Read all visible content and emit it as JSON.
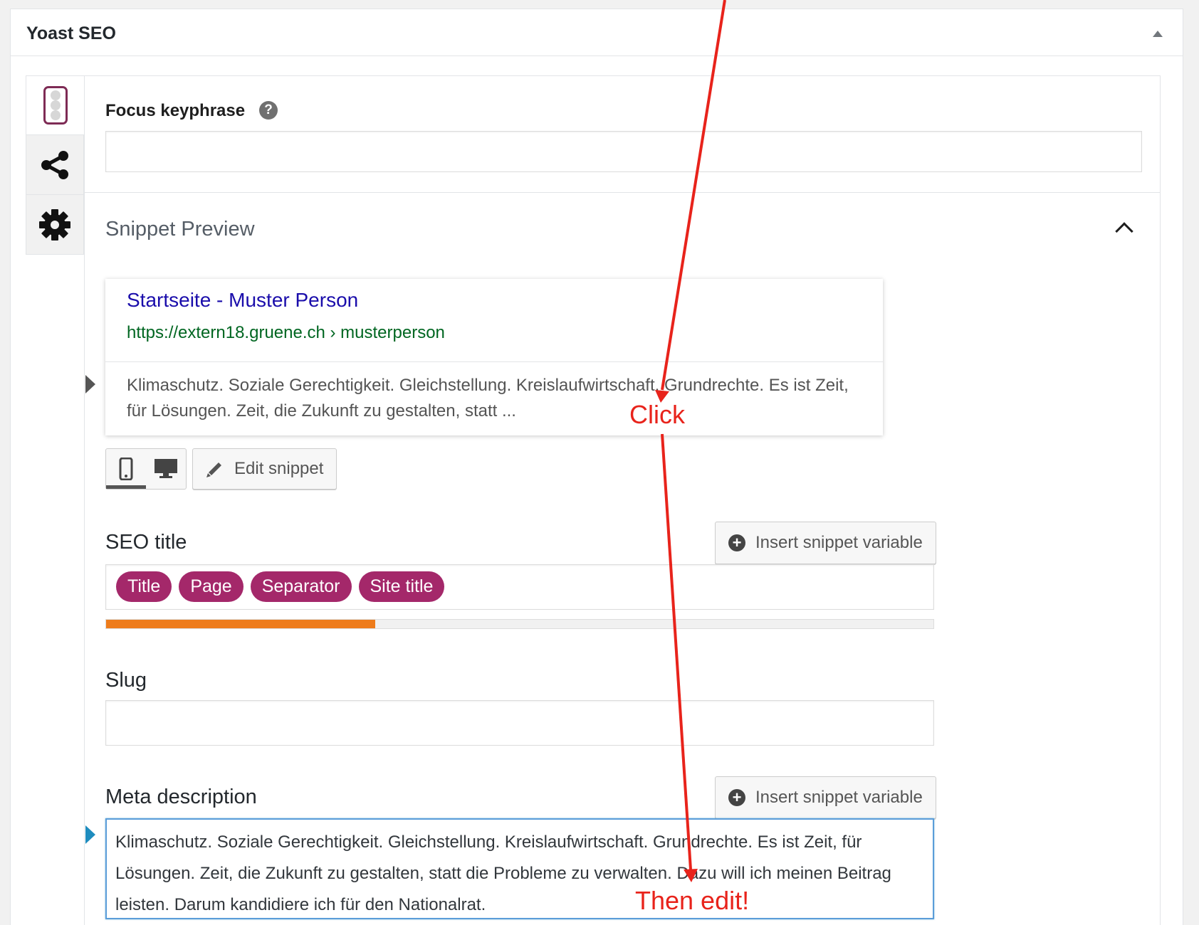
{
  "panel": {
    "title": "Yoast SEO"
  },
  "focus_keyphrase": {
    "label": "Focus keyphrase",
    "help": "?",
    "value": ""
  },
  "snippet_preview": {
    "heading": "Snippet Preview",
    "title": "Startseite - Muster Person",
    "url": "https://extern18.gruene.ch › musterperson",
    "description": "Klimaschutz. Soziale Gerechtigkeit. Gleichstellung. Kreislaufwirtschaft. Grundrechte. Es ist Zeit, für Lösungen. Zeit, die Zukunft zu gestalten, statt ...",
    "mode_active": "mobile",
    "edit_label": "Edit snippet"
  },
  "seo_title": {
    "label": "SEO title",
    "insert_label": "Insert snippet variable",
    "chips": [
      "Title",
      "Page",
      "Separator",
      "Site title"
    ],
    "progress": 0.325,
    "progress_color": "#ee7c1b"
  },
  "slug": {
    "label": "Slug",
    "value": ""
  },
  "meta_description": {
    "label": "Meta description",
    "insert_label": "Insert snippet variable",
    "value": "Klimaschutz. Soziale Gerechtigkeit. Gleichstellung. Kreislaufwirtschaft. Grundrechte. Es ist Zeit, für Lösungen. Zeit, die Zukunft zu gestalten, statt die Probleme zu verwalten. Dazu will ich meinen Beitrag leisten. Darum kandidiere ich für den Nationalrat."
  },
  "annotations": {
    "click": "Click",
    "edit": "Then edit!",
    "color": "#e8231b"
  },
  "colors": {
    "accent": "#a4286a",
    "link": "#1a0dab",
    "url": "#006621"
  }
}
